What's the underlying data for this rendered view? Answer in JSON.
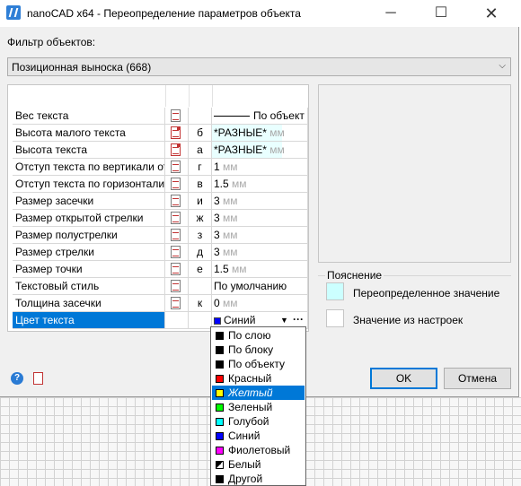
{
  "window": {
    "title": "nanoCAD x64 - Переопределение параметров объекта",
    "minimize_glyph": "─",
    "maximize_glyph": "☐",
    "close_glyph": "✕"
  },
  "filter": {
    "label": "Фильтр объектов:",
    "selected": "Позиционная выноска (668)"
  },
  "properties": [
    {
      "name": "Вес текста",
      "key": "",
      "value": "По объект",
      "unit": "",
      "icon": "override-icon"
    },
    {
      "name": "Высота малого текста",
      "key": "б",
      "value": "*РАЗНЫЕ*",
      "unit": "мм",
      "icon": "override-icon-red"
    },
    {
      "name": "Высота текста",
      "key": "а",
      "value": "*РАЗНЫЕ*",
      "unit": "мм",
      "icon": "override-icon-red"
    },
    {
      "name": "Отступ текста по вертикали от",
      "key": "г",
      "value": "1",
      "unit": "мм",
      "icon": "override-icon"
    },
    {
      "name": "Отступ текста по горизонтали",
      "key": "в",
      "value": "1.5",
      "unit": "мм",
      "icon": "override-icon"
    },
    {
      "name": "Размер засечки",
      "key": "и",
      "value": "3",
      "unit": "мм",
      "icon": "override-icon"
    },
    {
      "name": "Размер открытой стрелки",
      "key": "ж",
      "value": "3",
      "unit": "мм",
      "icon": "override-icon"
    },
    {
      "name": "Размер полустрелки",
      "key": "з",
      "value": "3",
      "unit": "мм",
      "icon": "override-icon"
    },
    {
      "name": "Размер стрелки",
      "key": "д",
      "value": "3",
      "unit": "мм",
      "icon": "override-icon"
    },
    {
      "name": "Размер точки",
      "key": "е",
      "value": "1.5",
      "unit": "мм",
      "icon": "override-icon"
    },
    {
      "name": "Текстовый стиль",
      "key": "",
      "value": "По умолчанию",
      "unit": "",
      "icon": "override-icon"
    },
    {
      "name": "Толщина засечки",
      "key": "к",
      "value": "0",
      "unit": "мм",
      "icon": "override-icon"
    },
    {
      "name": "Цвет текста",
      "key": "",
      "value": "Синий",
      "unit": "",
      "icon": "",
      "selected": true
    }
  ],
  "selected_row_controls": {
    "dropdown_glyph": "▼",
    "more_glyph": "···"
  },
  "legend": {
    "title": "Пояснение",
    "overridden_label": "Переопределенное значение",
    "overridden_color": "#ccffff",
    "default_label": "Значение из настроек",
    "default_color": "#ffffff"
  },
  "buttons": {
    "ok": "OK",
    "cancel": "Отмена",
    "help_glyph": "?"
  },
  "color_options": [
    {
      "label": "По слою",
      "color": "#000000"
    },
    {
      "label": "По блоку",
      "color": "#000000"
    },
    {
      "label": "По объекту",
      "color": "#000000"
    },
    {
      "label": "Красный",
      "color": "#ff0000"
    },
    {
      "label": "Желтый",
      "color": "#ffff00",
      "highlighted": true
    },
    {
      "label": "Зеленый",
      "color": "#00ff00"
    },
    {
      "label": "Голубой",
      "color": "#00ffff"
    },
    {
      "label": "Синий",
      "color": "#0000ff"
    },
    {
      "label": "Фиолетовый",
      "color": "#ff00ff"
    },
    {
      "label": "Белый",
      "color": "diagonal"
    },
    {
      "label": "Другой",
      "color": "#000000"
    }
  ],
  "colors": {
    "selection": "#0078d7",
    "selected_value_swatch": "#0000ff"
  }
}
